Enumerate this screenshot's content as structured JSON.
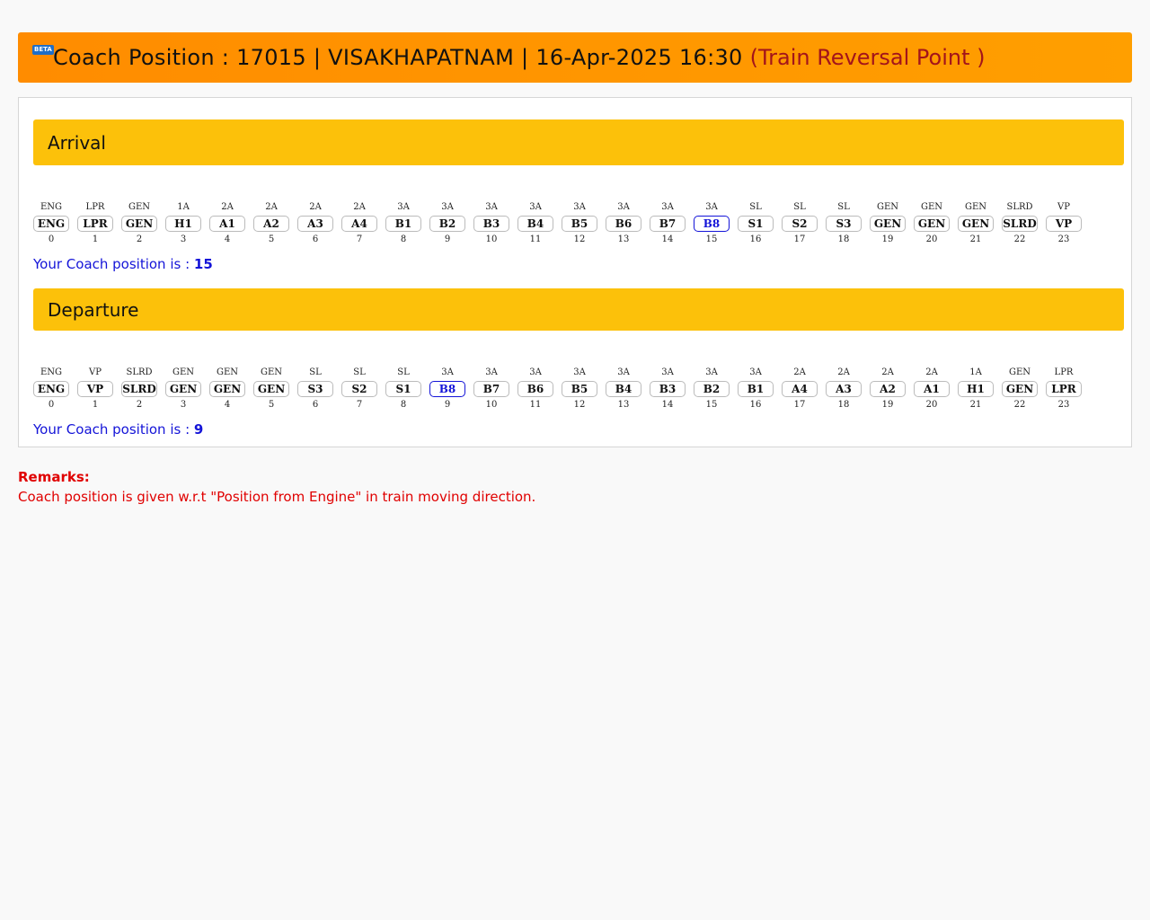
{
  "header": {
    "badge": "BETA",
    "title": "Coach Position : 17015 | VISAKHAPATNAM | 16-Apr-2025 16:30",
    "reversal": "(Train Reversal Point )"
  },
  "arrival": {
    "label": "Arrival",
    "position_text": "Your Coach position is : ",
    "position_value": "15",
    "highlight_index": 15,
    "coaches": [
      {
        "type": "ENG",
        "code": "ENG",
        "pos": "0"
      },
      {
        "type": "LPR",
        "code": "LPR",
        "pos": "1"
      },
      {
        "type": "GEN",
        "code": "GEN",
        "pos": "2"
      },
      {
        "type": "1A",
        "code": "H1",
        "pos": "3"
      },
      {
        "type": "2A",
        "code": "A1",
        "pos": "4"
      },
      {
        "type": "2A",
        "code": "A2",
        "pos": "5"
      },
      {
        "type": "2A",
        "code": "A3",
        "pos": "6"
      },
      {
        "type": "2A",
        "code": "A4",
        "pos": "7"
      },
      {
        "type": "3A",
        "code": "B1",
        "pos": "8"
      },
      {
        "type": "3A",
        "code": "B2",
        "pos": "9"
      },
      {
        "type": "3A",
        "code": "B3",
        "pos": "10"
      },
      {
        "type": "3A",
        "code": "B4",
        "pos": "11"
      },
      {
        "type": "3A",
        "code": "B5",
        "pos": "12"
      },
      {
        "type": "3A",
        "code": "B6",
        "pos": "13"
      },
      {
        "type": "3A",
        "code": "B7",
        "pos": "14"
      },
      {
        "type": "3A",
        "code": "B8",
        "pos": "15"
      },
      {
        "type": "SL",
        "code": "S1",
        "pos": "16"
      },
      {
        "type": "SL",
        "code": "S2",
        "pos": "17"
      },
      {
        "type": "SL",
        "code": "S3",
        "pos": "18"
      },
      {
        "type": "GEN",
        "code": "GEN",
        "pos": "19"
      },
      {
        "type": "GEN",
        "code": "GEN",
        "pos": "20"
      },
      {
        "type": "GEN",
        "code": "GEN",
        "pos": "21"
      },
      {
        "type": "SLRD",
        "code": "SLRD",
        "pos": "22"
      },
      {
        "type": "VP",
        "code": "VP",
        "pos": "23"
      }
    ]
  },
  "departure": {
    "label": "Departure",
    "position_text": "Your Coach position is : ",
    "position_value": "9",
    "highlight_index": 9,
    "coaches": [
      {
        "type": "ENG",
        "code": "ENG",
        "pos": "0"
      },
      {
        "type": "VP",
        "code": "VP",
        "pos": "1"
      },
      {
        "type": "SLRD",
        "code": "SLRD",
        "pos": "2"
      },
      {
        "type": "GEN",
        "code": "GEN",
        "pos": "3"
      },
      {
        "type": "GEN",
        "code": "GEN",
        "pos": "4"
      },
      {
        "type": "GEN",
        "code": "GEN",
        "pos": "5"
      },
      {
        "type": "SL",
        "code": "S3",
        "pos": "6"
      },
      {
        "type": "SL",
        "code": "S2",
        "pos": "7"
      },
      {
        "type": "SL",
        "code": "S1",
        "pos": "8"
      },
      {
        "type": "3A",
        "code": "B8",
        "pos": "9"
      },
      {
        "type": "3A",
        "code": "B7",
        "pos": "10"
      },
      {
        "type": "3A",
        "code": "B6",
        "pos": "11"
      },
      {
        "type": "3A",
        "code": "B5",
        "pos": "12"
      },
      {
        "type": "3A",
        "code": "B4",
        "pos": "13"
      },
      {
        "type": "3A",
        "code": "B3",
        "pos": "14"
      },
      {
        "type": "3A",
        "code": "B2",
        "pos": "15"
      },
      {
        "type": "3A",
        "code": "B1",
        "pos": "16"
      },
      {
        "type": "2A",
        "code": "A4",
        "pos": "17"
      },
      {
        "type": "2A",
        "code": "A3",
        "pos": "18"
      },
      {
        "type": "2A",
        "code": "A2",
        "pos": "19"
      },
      {
        "type": "2A",
        "code": "A1",
        "pos": "20"
      },
      {
        "type": "1A",
        "code": "H1",
        "pos": "21"
      },
      {
        "type": "GEN",
        "code": "GEN",
        "pos": "22"
      },
      {
        "type": "LPR",
        "code": "LPR",
        "pos": "23"
      }
    ]
  },
  "remarks": {
    "title": "Remarks:",
    "text": "Coach position is given w.r.t \"Position from Engine\" in train moving direction."
  }
}
